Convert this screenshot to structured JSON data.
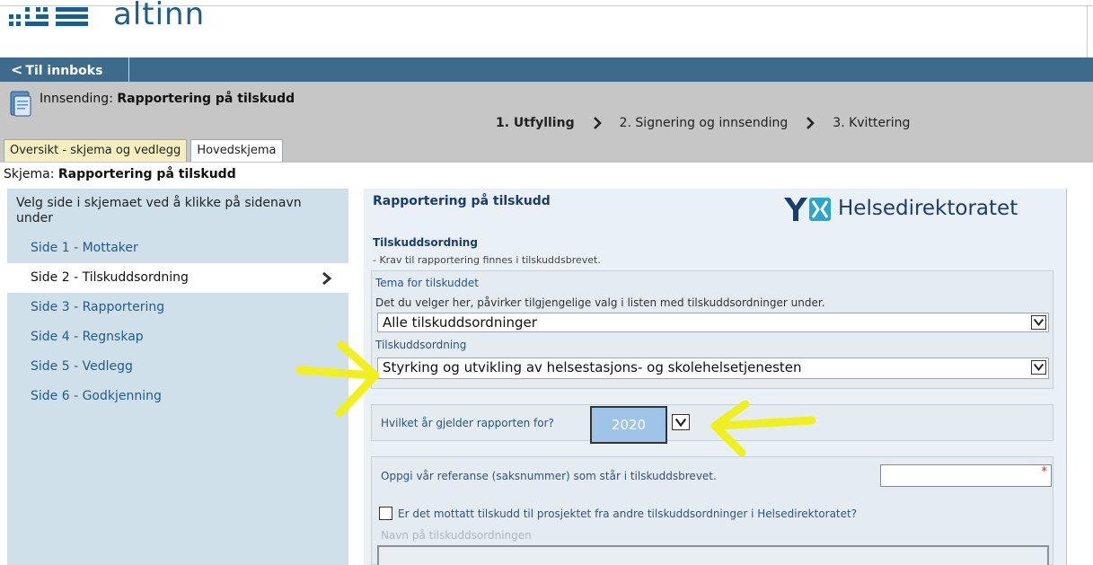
{
  "header": {
    "logo_text": "altinn",
    "back_label": "Til innboks"
  },
  "process": {
    "submission_prefix": "Innsending: ",
    "submission_name": "Rapportering på tilskudd",
    "steps": [
      "1. Utfylling",
      "2. Signering og innsending",
      "3. Kvittering"
    ],
    "tabs": [
      "Oversikt - skjema og vedlegg",
      "Hovedskjema"
    ]
  },
  "schema": {
    "prefix": "Skjema: ",
    "name": "Rapportering på tilskudd"
  },
  "sidebar": {
    "intro": "Velg side i skjemaet ved å klikke på sidenavn under",
    "items": [
      {
        "label": "Side 1 - Mottaker"
      },
      {
        "label": "Side 2 - Tilskuddsordning"
      },
      {
        "label": "Side 3 - Rapportering"
      },
      {
        "label": "Side 4 - Regnskap"
      },
      {
        "label": "Side 5 - Vedlegg"
      },
      {
        "label": "Side 6 - Godkjenning"
      }
    ],
    "active_index": 1
  },
  "form": {
    "title": "Rapportering på tilskudd",
    "org_logo_text": "Helsedirektoratet",
    "section_title": "Tilskuddsordning",
    "section_sub": "- Krav til rapportering finnes i tilskuddsbrevet.",
    "theme_label": "Tema for tilskuddet",
    "theme_help": "Det du velger her, påvirker tilgjengelige valg i listen med tilskuddsordninger under.",
    "theme_value": "Alle tilskuddsordninger",
    "scheme_label": "Tilskuddsordning",
    "scheme_value": "Styrking og utvikling av helsestasjons- og skolehelsetjenesten",
    "year_label": "Hvilket år gjelder rapporten for?",
    "year_value": "2020",
    "ref_label": "Oppgi vår referanse (saksnummer) som står i tilskuddsbrevet.",
    "required_mark": "*",
    "other_grants_label": "Er det mottatt tilskudd til prosjektet fra andre tilskuddsordninger i Helsedirektoratet?",
    "other_grants_name_label": "Navn på tilskuddsordningen"
  },
  "colors": {
    "navbar": "#3e6b8c",
    "process_bg": "#c6c6c6",
    "sidebar_bg": "#cfe0ea",
    "main_bg": "#eaf1f6",
    "annotation": "#f0f020"
  },
  "icons": {
    "back": "chevron-left-icon",
    "document": "document-icon",
    "step_separator": "chevron-right-icon",
    "active_page": "chevron-right-icon",
    "dropdown": "chevron-down-icon"
  }
}
